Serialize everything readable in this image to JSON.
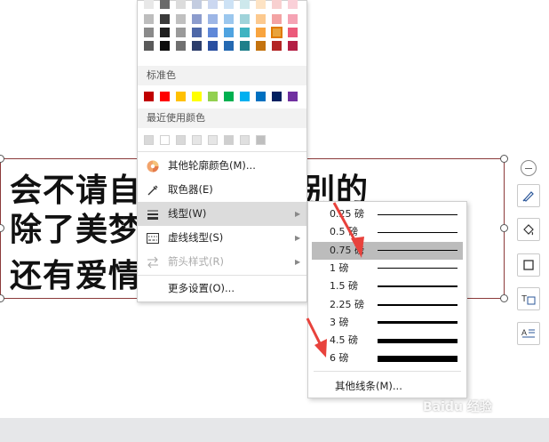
{
  "slide": {
    "lines": [
      "会不请自",
      "别的",
      "除了美梦",
      "还有爱情"
    ]
  },
  "menu": {
    "theme_colors": [
      [
        "#e8e8e8",
        "#6b6b6b",
        "#dcdcdc",
        "#c3cce0",
        "#cbd7f0",
        "#cde2f5",
        "#cde8ec",
        "#fde3c4",
        "#f8d0d0",
        "#fad0d8"
      ],
      [
        "#bdbdbd",
        "#3a3a3a",
        "#c0c0c0",
        "#8c9ccd",
        "#9db6e6",
        "#9bc7ee",
        "#9fd3da",
        "#fcc98e",
        "#f3a3a3",
        "#f5a3b4"
      ],
      [
        "#8a8a8a",
        "#1f1f1f",
        "#9a9a9a",
        "#4e68a8",
        "#5f88d8",
        "#4fa3e0",
        "#3fb3c1",
        "#f8a43f",
        "#e76b6b",
        "#eb5a7a"
      ],
      [
        "#5a5a5a",
        "#0d0d0d",
        "#707070",
        "#2c3d6b",
        "#2a4fa0",
        "#2469b2",
        "#1f7f8a",
        "#c4730e",
        "#b32424",
        "#b41f45"
      ]
    ],
    "selected_theme_color": "#e8a33c",
    "standard_colors_label": "标准色",
    "standard_colors": [
      "#c00000",
      "#ff0000",
      "#ffc000",
      "#ffff00",
      "#92d050",
      "#00b050",
      "#00b0f0",
      "#0070c0",
      "#002060",
      "#7030a0"
    ],
    "recent_colors_label": "最近使用颜色",
    "recent_colors": [
      "#d9d9d9",
      "#ffffff",
      "#d9d9d9",
      "#e6e6e6",
      "#e6e6e6",
      "#cfcfcf",
      "#e0e0e0",
      "#bfbfbf"
    ],
    "items": {
      "more_outline_colors": "其他轮廓颜色(M)...",
      "eyedropper": "取色器(E)",
      "line_type": "线型(W)",
      "dash_type": "虚线线型(S)",
      "arrow_style": "箭头样式(R)",
      "more_settings": "更多设置(O)..."
    }
  },
  "line_weights": {
    "options": [
      {
        "label": "0.25 磅",
        "weight": 0.25
      },
      {
        "label": "0.5 磅",
        "weight": 0.5
      },
      {
        "label": "0.75 磅",
        "weight": 0.75
      },
      {
        "label": "1 磅",
        "weight": 1
      },
      {
        "label": "1.5 磅",
        "weight": 1.5
      },
      {
        "label": "2.25 磅",
        "weight": 2.25
      },
      {
        "label": "3 磅",
        "weight": 3
      },
      {
        "label": "4.5 磅",
        "weight": 4.5
      },
      {
        "label": "6 磅",
        "weight": 6
      }
    ],
    "selected": "0.75 磅",
    "more_lines_label": "其他线条(M)..."
  },
  "watermark": "Baidu 经验",
  "colors": {
    "annotation_arrow": "#e8423c",
    "highlight": "#dcdcdc",
    "selection_border": "#8b3a3a"
  }
}
